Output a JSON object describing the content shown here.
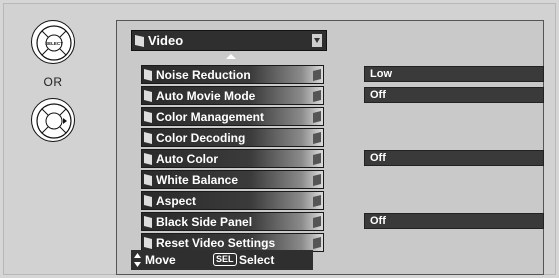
{
  "remote": {
    "select_button_label": "SELECT",
    "or_text": "OR"
  },
  "menu": {
    "title": "Video",
    "items": [
      {
        "label": "Noise Reduction",
        "value": "Low"
      },
      {
        "label": "Auto Movie Mode",
        "value": "Off"
      },
      {
        "label": "Color Management",
        "value": null
      },
      {
        "label": "Color Decoding",
        "value": null
      },
      {
        "label": "Auto Color",
        "value": "Off"
      },
      {
        "label": "White Balance",
        "value": null
      },
      {
        "label": "Aspect",
        "value": null
      },
      {
        "label": "Black Side Panel",
        "value": "Off"
      },
      {
        "label": "Reset Video Settings",
        "value": null
      }
    ]
  },
  "footer": {
    "move_label": "Move",
    "sel_key": "SEL",
    "select_label": "Select"
  },
  "colors": {
    "menu_dark": "#2f2f2f",
    "panel_bg": "#c9c9c9",
    "page_bg": "#d6d6d6"
  }
}
